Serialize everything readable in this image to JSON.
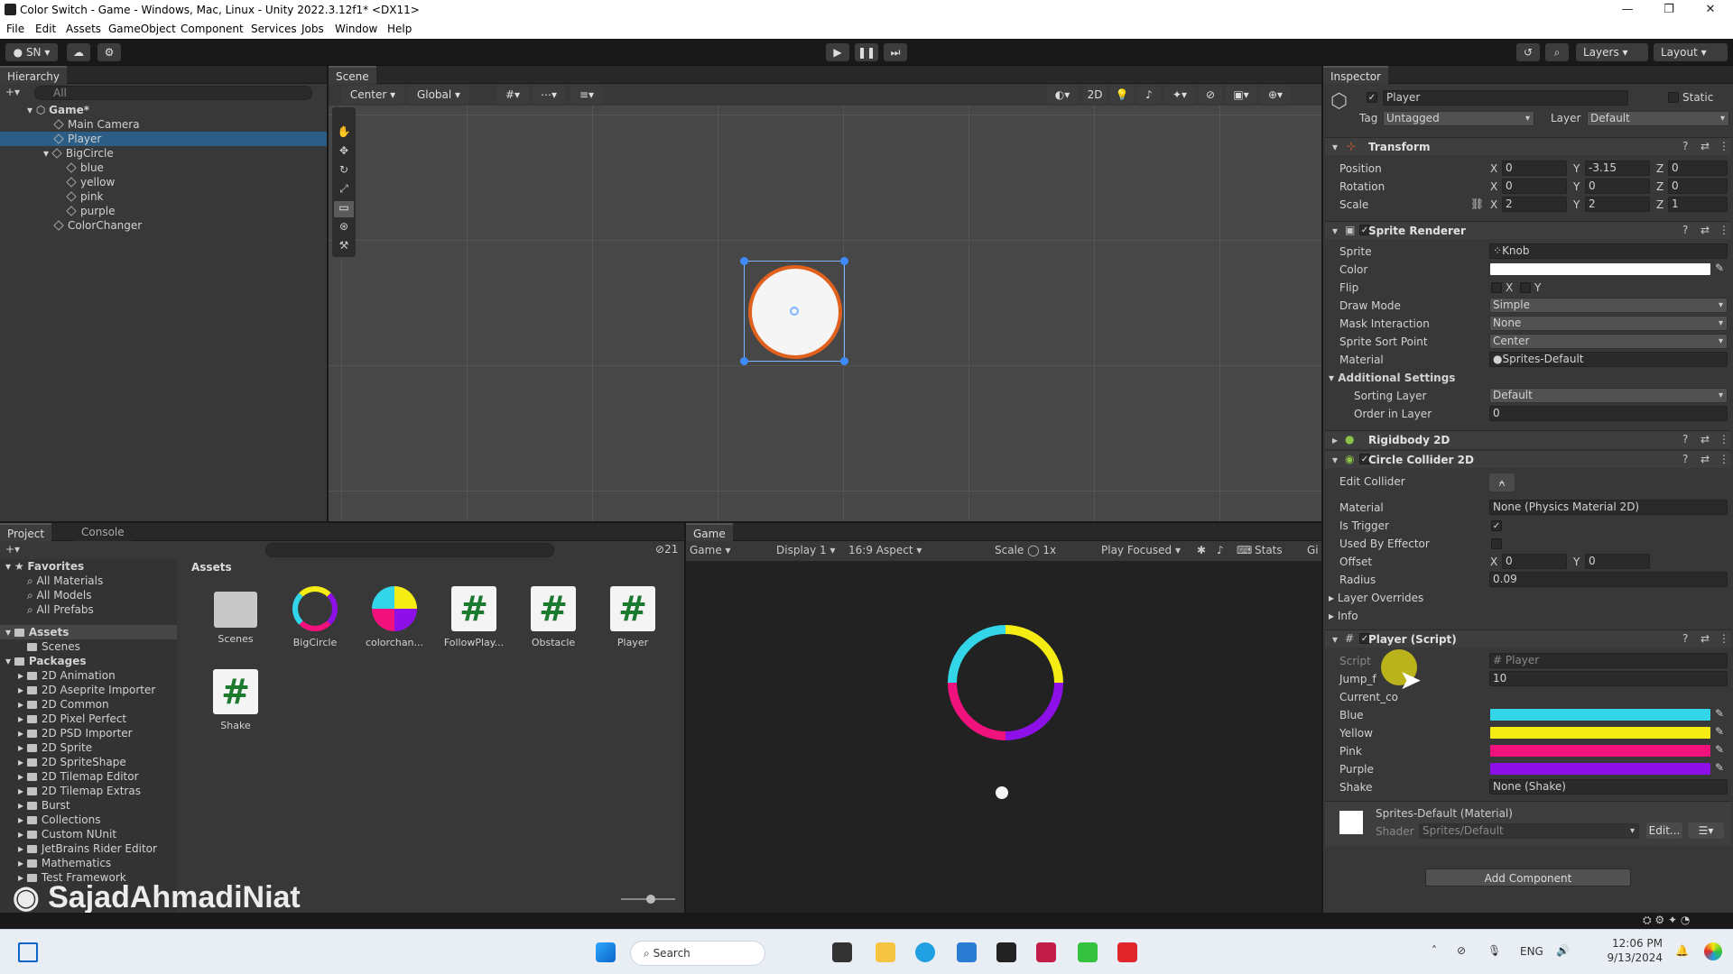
{
  "window": {
    "title": "Color Switch - Game - Windows, Mac, Linux - Unity 2022.3.12f1* <DX11>"
  },
  "menu": [
    "File",
    "Edit",
    "Assets",
    "GameObject",
    "Component",
    "Services",
    "Jobs",
    "Window",
    "Help"
  ],
  "toolbar": {
    "account": "SN",
    "layers": "Layers",
    "layout": "Layout"
  },
  "hierarchy": {
    "tab": "Hierarchy",
    "search": "All",
    "items": [
      {
        "label": "Game*"
      },
      {
        "label": "Main Camera"
      },
      {
        "label": "Player"
      },
      {
        "label": "BigCircle"
      },
      {
        "label": "blue"
      },
      {
        "label": "yellow"
      },
      {
        "label": "pink"
      },
      {
        "label": "purple"
      },
      {
        "label": "ColorChanger"
      }
    ]
  },
  "scene": {
    "tab": "Scene",
    "pivot": "Center",
    "space": "Global",
    "mode2d": "2D"
  },
  "project": {
    "tabs": [
      "Project",
      "Console"
    ],
    "count": "21",
    "favorites": {
      "title": "Favorites",
      "items": [
        "All Materials",
        "All Models",
        "All Prefabs"
      ]
    },
    "assets_title": "Assets",
    "assets_tree": [
      "Scenes"
    ],
    "packages_title": "Packages",
    "packages": [
      "2D Animation",
      "2D Aseprite Importer",
      "2D Common",
      "2D Pixel Perfect",
      "2D PSD Importer",
      "2D Sprite",
      "2D SpriteShape",
      "2D Tilemap Editor",
      "2D Tilemap Extras",
      "Burst",
      "Collections",
      "Custom NUnit",
      "JetBrains Rider Editor",
      "Mathematics",
      "Test Framework"
    ],
    "breadcrumb": "Assets",
    "grid": [
      {
        "name": "Scenes",
        "kind": "folder"
      },
      {
        "name": "BigCircle",
        "kind": "prefab"
      },
      {
        "name": "colorchan...",
        "kind": "prefab"
      },
      {
        "name": "FollowPlay...",
        "kind": "script"
      },
      {
        "name": "Obstacle",
        "kind": "script"
      },
      {
        "name": "Player",
        "kind": "script"
      },
      {
        "name": "Shake",
        "kind": "script"
      }
    ]
  },
  "game": {
    "tab": "Game",
    "display_mode": "Game",
    "display": "Display 1",
    "aspect": "16:9 Aspect",
    "scale_label": "Scale",
    "scale": "1x",
    "play_mode": "Play Focused",
    "stats": "Stats",
    "gizmos": "Gi"
  },
  "inspector": {
    "tab": "Inspector",
    "object_name": "Player",
    "static": "Static",
    "tag_label": "Tag",
    "tag": "Untagged",
    "layer_label": "Layer",
    "layer": "Default",
    "transform": {
      "title": "Transform",
      "position_label": "Position",
      "rotation_label": "Rotation",
      "scale_label": "Scale",
      "position": {
        "x": "0",
        "y": "-3.15",
        "z": "0"
      },
      "rotation": {
        "x": "0",
        "y": "0",
        "z": "0"
      },
      "scale": {
        "x": "2",
        "y": "2",
        "z": "1"
      }
    },
    "sprite_renderer": {
      "title": "Sprite Renderer",
      "sprite_label": "Sprite",
      "sprite": "Knob",
      "color_label": "Color",
      "flip_label": "Flip",
      "flip_x": "X",
      "flip_y": "Y",
      "draw_mode_label": "Draw Mode",
      "draw_mode": "Simple",
      "mask_label": "Mask Interaction",
      "mask": "None",
      "sort_point_label": "Sprite Sort Point",
      "sort_point": "Center",
      "material_label": "Material",
      "material": "Sprites-Default",
      "additional": "Additional Settings",
      "sorting_layer_label": "Sorting Layer",
      "sorting_layer": "Default",
      "order_label": "Order in Layer",
      "order": "0"
    },
    "rigidbody": {
      "title": "Rigidbody 2D"
    },
    "collider": {
      "title": "Circle Collider 2D",
      "edit_label": "Edit Collider",
      "material_label": "Material",
      "material": "None (Physics Material 2D)",
      "trigger_label": "Is Trigger",
      "effector_label": "Used By Effector",
      "offset_label": "Offset",
      "offset": {
        "x": "0",
        "y": "0"
      },
      "radius_label": "Radius",
      "radius": "0.09",
      "overrides": "Layer Overrides",
      "info": "Info"
    },
    "player_script": {
      "title": "Player (Script)",
      "script_label": "Script",
      "script": "Player",
      "jump_label": "Jump_f",
      "jump": "10",
      "current_label": "Current_co",
      "colors": [
        {
          "label": "Blue",
          "hex": "#32d6e8"
        },
        {
          "label": "Yellow",
          "hex": "#f4ec12"
        },
        {
          "label": "Pink",
          "hex": "#f2127e"
        },
        {
          "label": "Purple",
          "hex": "#8e10e8"
        }
      ],
      "shake_label": "Shake",
      "shake": "None (Shake)"
    },
    "material_footer": {
      "title": "Sprites-Default (Material)",
      "shader_label": "Shader",
      "shader": "Sprites/Default",
      "edit": "Edit..."
    },
    "add_component": "Add Component"
  },
  "watermark": "SajadAhmadiNiat",
  "taskbar": {
    "search": "Search",
    "lang": "ENG",
    "time": "12:06 PM",
    "date": "9/13/2024"
  }
}
